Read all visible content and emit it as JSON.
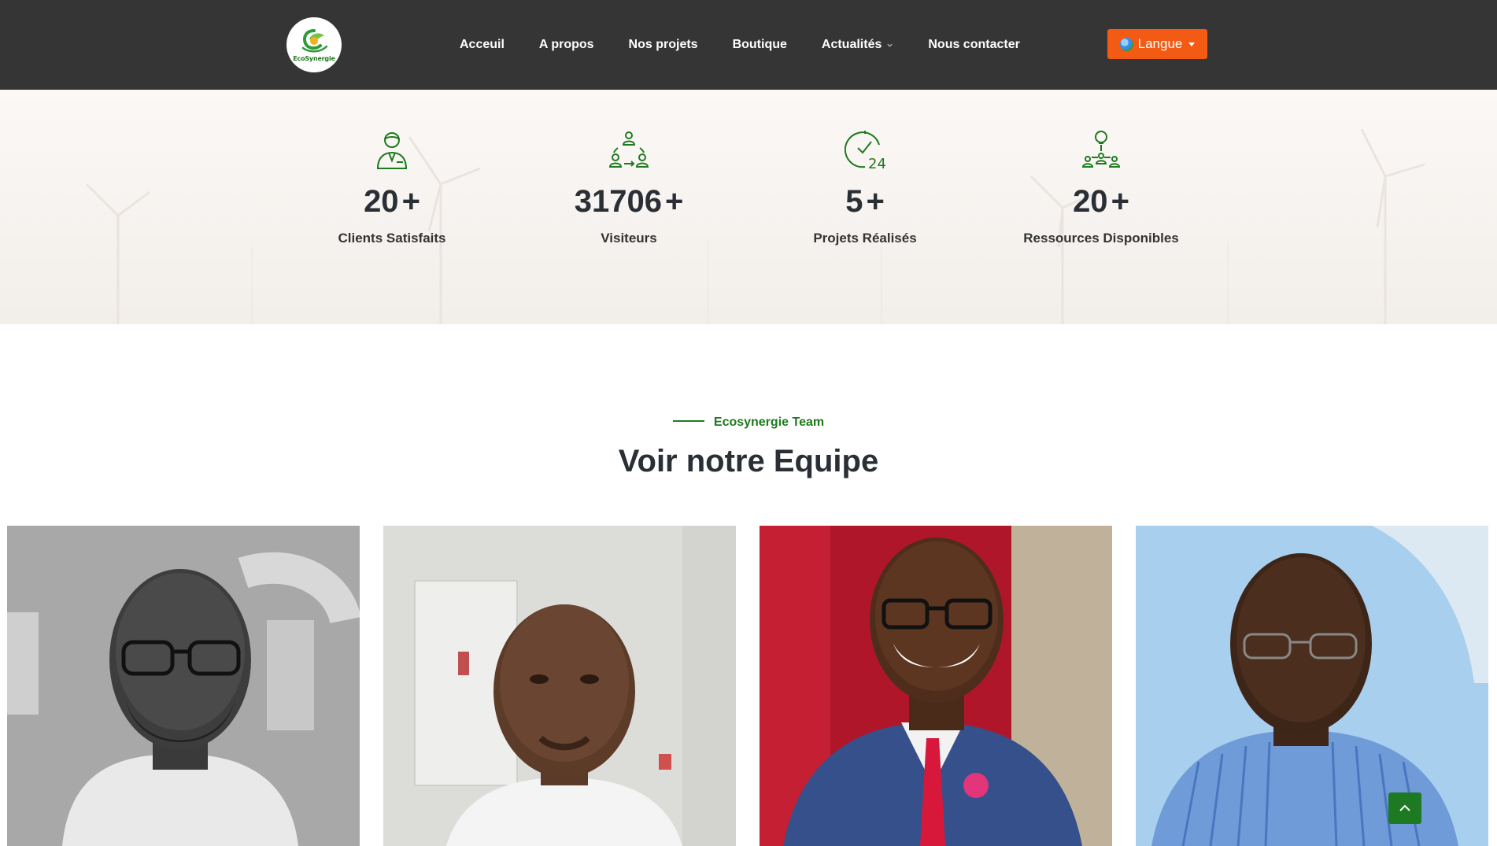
{
  "header": {
    "logo_text": "EcoSynergie",
    "nav": [
      {
        "label": "Acceuil"
      },
      {
        "label": "A propos"
      },
      {
        "label": "Nos projets"
      },
      {
        "label": "Boutique"
      },
      {
        "label": "Actualités",
        "has_dropdown": true
      },
      {
        "label": "Nous contacter"
      }
    ],
    "language_button": "Langue",
    "language_icon": "globe-icon"
  },
  "stats": [
    {
      "icon": "client-user-icon",
      "value": "20",
      "suffix": "+",
      "label": "Clients Satisfaits"
    },
    {
      "icon": "visitors-cycle-icon",
      "value": "31706",
      "suffix": "+",
      "label": "Visiteurs"
    },
    {
      "icon": "clock-24-check-icon",
      "value": "5",
      "suffix": "+",
      "label": "Projets Réalisés"
    },
    {
      "icon": "lightbulb-network-icon",
      "value": "20",
      "suffix": "+",
      "label": "Ressources Disponibles"
    }
  ],
  "team": {
    "eyebrow": "Ecosynergie Team",
    "title": "Voir notre Equipe"
  },
  "colors": {
    "header_bg": "#353535",
    "accent_orange": "#f35b15",
    "brand_green": "#1e7a1e",
    "heading_dark": "#2a2f36"
  },
  "back_to_top_icon": "chevron-up-icon"
}
